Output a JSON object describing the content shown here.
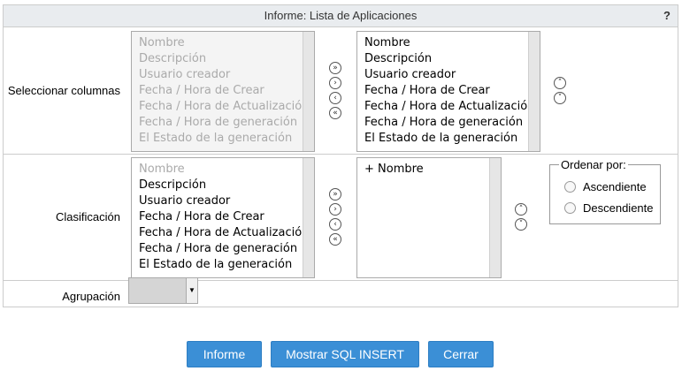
{
  "title": "Informe: Lista de Aplicaciones",
  "help_label": "?",
  "rows": {
    "columns_label": "Seleccionar columnas",
    "sort_label": "Clasificación",
    "group_label": "Agrupación"
  },
  "columns_available": [
    "Nombre",
    "Descripción",
    "Usuario creador",
    "Fecha / Hora de Crear",
    "Fecha / Hora de Actualización",
    "Fecha / Hora de generación",
    "El Estado de la generación"
  ],
  "columns_selected": [
    "Nombre",
    "Descripción",
    "Usuario creador",
    "Fecha / Hora de Crear",
    "Fecha / Hora de Actualización",
    "Fecha / Hora de generación",
    "El Estado de la generación"
  ],
  "sort_available": [
    "Nombre",
    "Descripción",
    "Usuario creador",
    "Fecha / Hora de Crear",
    "Fecha / Hora de Actualización",
    "Fecha / Hora de generación",
    "El Estado de la generación"
  ],
  "sort_selected": [
    "+ Nombre"
  ],
  "order": {
    "legend": "Ordenar por:",
    "ascending": "Ascendiente",
    "descending": "Descendiente"
  },
  "icons": {
    "add_all": "»",
    "add": "›",
    "remove": "‹",
    "remove_all": "«",
    "up": "˄",
    "down": "˅",
    "dropdown": "▼"
  },
  "buttons": {
    "report": "Informe",
    "show_sql": "Mostrar SQL INSERT",
    "close": "Cerrar"
  },
  "colors": {
    "button_bg": "#3b8fd6",
    "title_bg": "#e9ecef"
  }
}
